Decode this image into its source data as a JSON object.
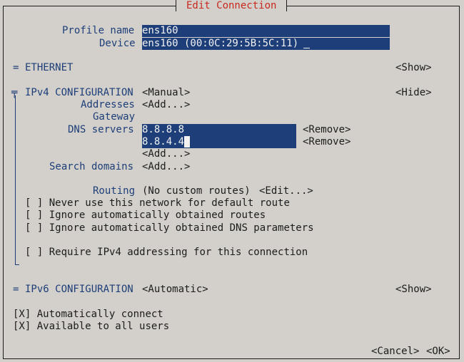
{
  "window": {
    "title": "Edit Connection"
  },
  "profile": {
    "name_label": "Profile name",
    "name_value": "ens160",
    "device_label": "Device",
    "device_value": "ens160 (00:0C:29:5B:5C:11)"
  },
  "ethernet": {
    "marker": "=",
    "label": "ETHERNET",
    "toggle": "<Show>"
  },
  "ipv4": {
    "marker": "╤",
    "label": "IPv4 CONFIGURATION",
    "mode": "<Manual>",
    "toggle": "<Hide>",
    "addresses_label": "Addresses",
    "addresses_add": "<Add...>",
    "gateway_label": "Gateway",
    "gateway_value": "",
    "dns_label": "DNS servers",
    "dns": [
      {
        "value": "8.8.8.8",
        "remove": "<Remove>"
      },
      {
        "value": "8.8.4.4",
        "remove": "<Remove>"
      }
    ],
    "dns_add": "<Add...>",
    "search_label": "Search domains",
    "search_add": "<Add...>",
    "routing_label": "Routing",
    "routing_value": "(No custom routes)",
    "routing_edit": "<Edit...>",
    "options": [
      {
        "mark": "[ ]",
        "label": "Never use this network for default route"
      },
      {
        "mark": "[ ]",
        "label": "Ignore automatically obtained routes"
      },
      {
        "mark": "[ ]",
        "label": "Ignore automatically obtained DNS parameters"
      }
    ],
    "require": {
      "mark": "[ ]",
      "label": "Require IPv4 addressing for this connection"
    }
  },
  "ipv6": {
    "marker": "=",
    "label": "IPv6 CONFIGURATION",
    "mode": "<Automatic>",
    "toggle": "<Show>"
  },
  "auto_connect": {
    "mark": "[X]",
    "label": "Automatically connect"
  },
  "all_users": {
    "mark": "[X]",
    "label": "Available to all users"
  },
  "footer": {
    "cancel": "<Cancel>",
    "ok": "<OK>"
  }
}
